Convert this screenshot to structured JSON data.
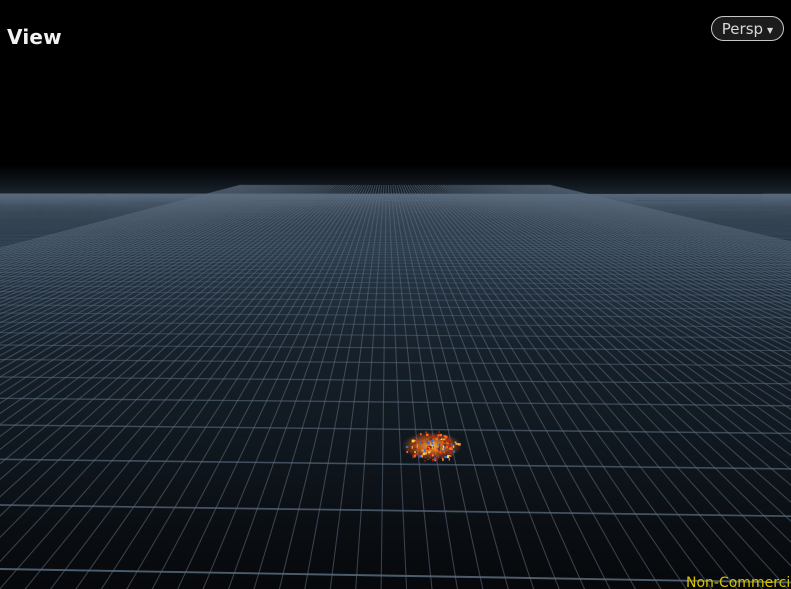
{
  "viewport": {
    "title": "View",
    "camera_menu": {
      "selected": "Persp",
      "caret_icon": "chevron-down-icon"
    },
    "watermark": "Non-Commercial"
  },
  "colors": {
    "background": "#000000",
    "grid_line": "#5c6e80",
    "floor_glow": "#2a3d4e",
    "particle_hot": "#ff6a1a",
    "particle_core": "#ffd24a",
    "watermark": "#d8c300"
  },
  "icons": [
    "chevron-down-icon",
    "grid-floor",
    "particle-burst"
  ]
}
